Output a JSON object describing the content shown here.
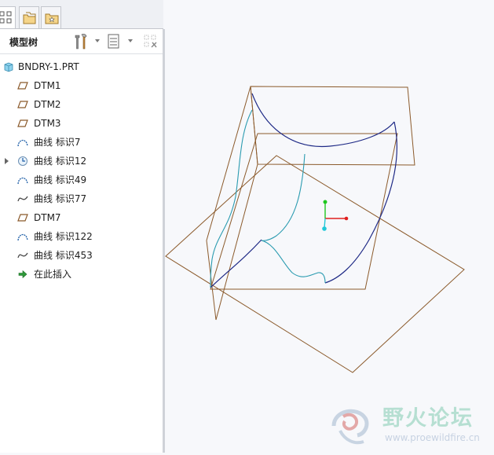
{
  "header": {
    "title": "模型树"
  },
  "tree": {
    "root": {
      "label": "BNDRY-1.PRT",
      "icon": "part-icon"
    },
    "items": [
      {
        "label": "DTM1",
        "icon": "datum-plane-icon",
        "expandable": false
      },
      {
        "label": "DTM2",
        "icon": "datum-plane-icon",
        "expandable": false
      },
      {
        "label": "DTM3",
        "icon": "datum-plane-icon",
        "expandable": false
      },
      {
        "label": "曲线 标识7",
        "icon": "sketched-curve-icon",
        "expandable": false
      },
      {
        "label": "曲线 标识12",
        "icon": "curve-feature-icon",
        "expandable": true
      },
      {
        "label": "曲线 标识49",
        "icon": "sketched-curve-icon",
        "expandable": false
      },
      {
        "label": "曲线 标识77",
        "icon": "spline-curve-icon",
        "expandable": false
      },
      {
        "label": "DTM7",
        "icon": "datum-plane-icon",
        "expandable": false
      },
      {
        "label": "曲线 标识122",
        "icon": "sketched-curve-icon",
        "expandable": false
      },
      {
        "label": "曲线 标识453",
        "icon": "spline-curve-icon",
        "expandable": false
      },
      {
        "label": "在此插入",
        "icon": "insert-here-arrow-icon",
        "expandable": false
      }
    ]
  },
  "watermark": {
    "title": "野火论坛",
    "url": "www.proewildfire.cn"
  },
  "colors": {
    "datum_plane": "#8b5a2b",
    "curve_dark": "#1f2a86",
    "curve_cyan": "#2a9bb0",
    "csys_y": "#1ec81e",
    "csys_x": "#e02020",
    "csys_z": "#20c8d8"
  }
}
